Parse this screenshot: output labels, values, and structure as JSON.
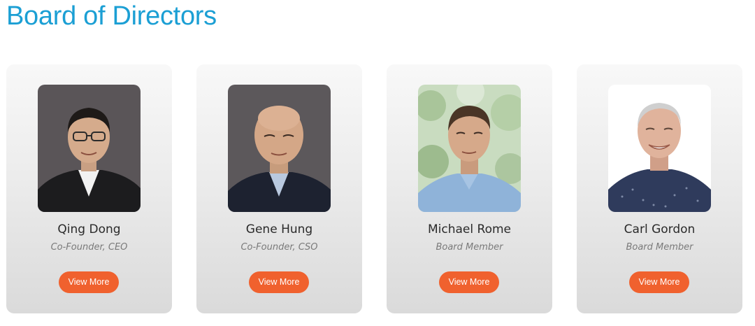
{
  "section": {
    "title": "Board of Directors"
  },
  "members": [
    {
      "name": "Qing Dong",
      "role": "Co-Founder, CEO",
      "button": "View More"
    },
    {
      "name": "Gene Hung",
      "role": "Co-Founder, CSO",
      "button": "View More"
    },
    {
      "name": "Michael Rome",
      "role": "Board Member",
      "button": "View More"
    },
    {
      "name": "Carl Gordon",
      "role": "Board Member",
      "button": "View More"
    }
  ],
  "colors": {
    "heading": "#1b9fd4",
    "button": "#f0612e",
    "card_top": "#f8f8f8",
    "card_bottom": "#dadada"
  }
}
